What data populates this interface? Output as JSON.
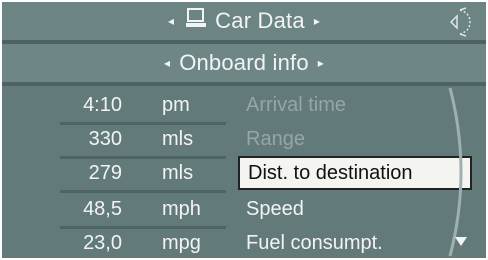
{
  "header": {
    "title": "Car Data"
  },
  "subheader": {
    "title": "Onboard info"
  },
  "rows": [
    {
      "value": "4:10",
      "unit": "pm",
      "label": "Arrival time"
    },
    {
      "value": "330",
      "unit": "mls",
      "label": "Range"
    },
    {
      "value": "279",
      "unit": "mls",
      "label": "Dist. to destination"
    },
    {
      "value": "48,5",
      "unit": "mph",
      "label": "Speed"
    },
    {
      "value": "23,0",
      "unit": "mpg",
      "label": "Fuel consumpt."
    }
  ],
  "icons": [
    "left-arrow-icon",
    "computer-icon",
    "right-arrow-icon",
    "controller-nav-icon",
    "scroll-down-icon"
  ]
}
